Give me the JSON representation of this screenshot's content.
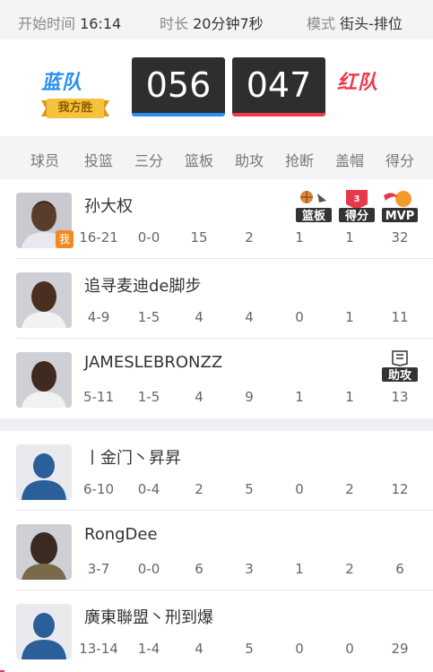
{
  "match": {
    "start_label": "开始时间",
    "start_value": "16:14",
    "duration_label": "时长",
    "duration_value": "20分钟7秒",
    "mode_label": "模式",
    "mode_value": "街头-排位"
  },
  "score": {
    "blue_team": "蓝队",
    "red_team": "红队",
    "blue_score": "056",
    "red_score": "047",
    "separator": ":",
    "winner_tag": "我方胜"
  },
  "columns": [
    "球员",
    "投篮",
    "三分",
    "篮板",
    "助攻",
    "抢断",
    "盖帽",
    "得分"
  ],
  "blue_players": [
    {
      "name": "孙大权",
      "shots": "16-21",
      "threes": "0-0",
      "rebounds": "15",
      "assists": "2",
      "steals": "1",
      "blocks": "1",
      "points": "32",
      "me_tag": "我",
      "badges": [
        "篮板",
        "得分",
        "MVP"
      ]
    },
    {
      "name": "追寻麦迪de脚步",
      "shots": "4-9",
      "threes": "1-5",
      "rebounds": "4",
      "assists": "4",
      "steals": "0",
      "blocks": "1",
      "points": "11",
      "badges": []
    },
    {
      "name": "JAMESLEBRONZZ",
      "shots": "5-11",
      "threes": "1-5",
      "rebounds": "4",
      "assists": "9",
      "steals": "1",
      "blocks": "1",
      "points": "13",
      "badges": [
        "助攻"
      ]
    }
  ],
  "red_players": [
    {
      "name": "丨金门丶昇昇",
      "shots": "6-10",
      "threes": "0-4",
      "rebounds": "2",
      "assists": "5",
      "steals": "0",
      "blocks": "2",
      "points": "12"
    },
    {
      "name": "RongDee",
      "shots": "3-7",
      "threes": "0-0",
      "rebounds": "6",
      "assists": "3",
      "steals": "1",
      "blocks": "2",
      "points": "6"
    },
    {
      "name": "廣東聯盟丶刑到爆",
      "shots": "13-14",
      "threes": "1-4",
      "rebounds": "4",
      "assists": "5",
      "steals": "0",
      "blocks": "0",
      "points": "29"
    }
  ],
  "colors": {
    "blue": "#2a8ff0",
    "red": "#f0394a",
    "score_bg": "#2e2e2e"
  },
  "icons": [
    "rebound-badge-icon",
    "score-badge-icon",
    "mvp-badge-icon",
    "assist-badge-icon",
    "default-avatar-icon"
  ]
}
